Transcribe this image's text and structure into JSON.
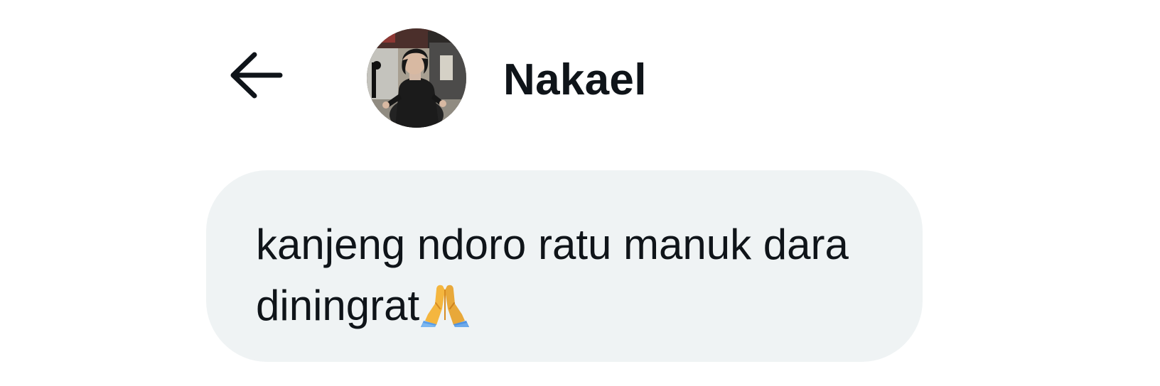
{
  "header": {
    "back_icon": "arrow-left-icon",
    "avatar_icon": "profile-photo",
    "contact_name": "Nakael"
  },
  "message": {
    "text": "kanjeng ndoro ratu manuk dara diningrat",
    "emoji": "folded-hands-icon",
    "bubble_color": "#eff3f4",
    "text_color": "#0f1419"
  }
}
